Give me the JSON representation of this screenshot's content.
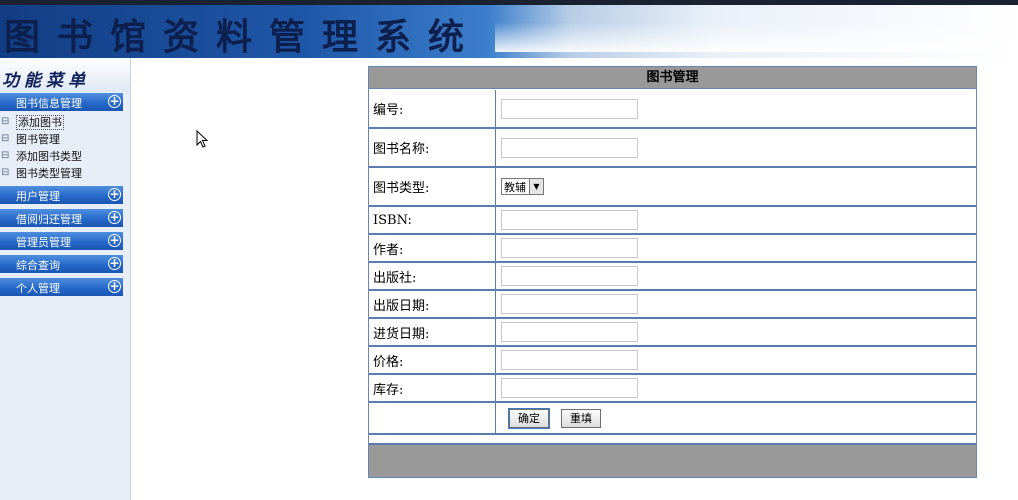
{
  "header": {
    "title": "图书馆资料管理系统"
  },
  "sidebar": {
    "menu_title": "功能菜单",
    "groups": [
      {
        "label": "图书信息管理",
        "items": [
          "添加图书",
          "图书管理",
          "添加图书类型",
          "图书类型管理"
        ]
      },
      {
        "label": "用户管理"
      },
      {
        "label": "借阅归还管理"
      },
      {
        "label": "管理员管理"
      },
      {
        "label": "综合查询"
      },
      {
        "label": "个人管理"
      }
    ]
  },
  "form": {
    "title": "图书管理",
    "fields": [
      {
        "label": "编号:",
        "value": ""
      },
      {
        "label": "图书名称:",
        "value": ""
      },
      {
        "label": "图书类型:",
        "value": "教辅"
      },
      {
        "label": "ISBN:",
        "value": ""
      },
      {
        "label": "作者:",
        "value": ""
      },
      {
        "label": "出版社:",
        "value": ""
      },
      {
        "label": "出版日期:",
        "value": ""
      },
      {
        "label": "进货日期:",
        "value": ""
      },
      {
        "label": "价格:",
        "value": ""
      },
      {
        "label": "库存:",
        "value": ""
      }
    ],
    "confirm_label": "确定",
    "reset_label": "重填"
  }
}
